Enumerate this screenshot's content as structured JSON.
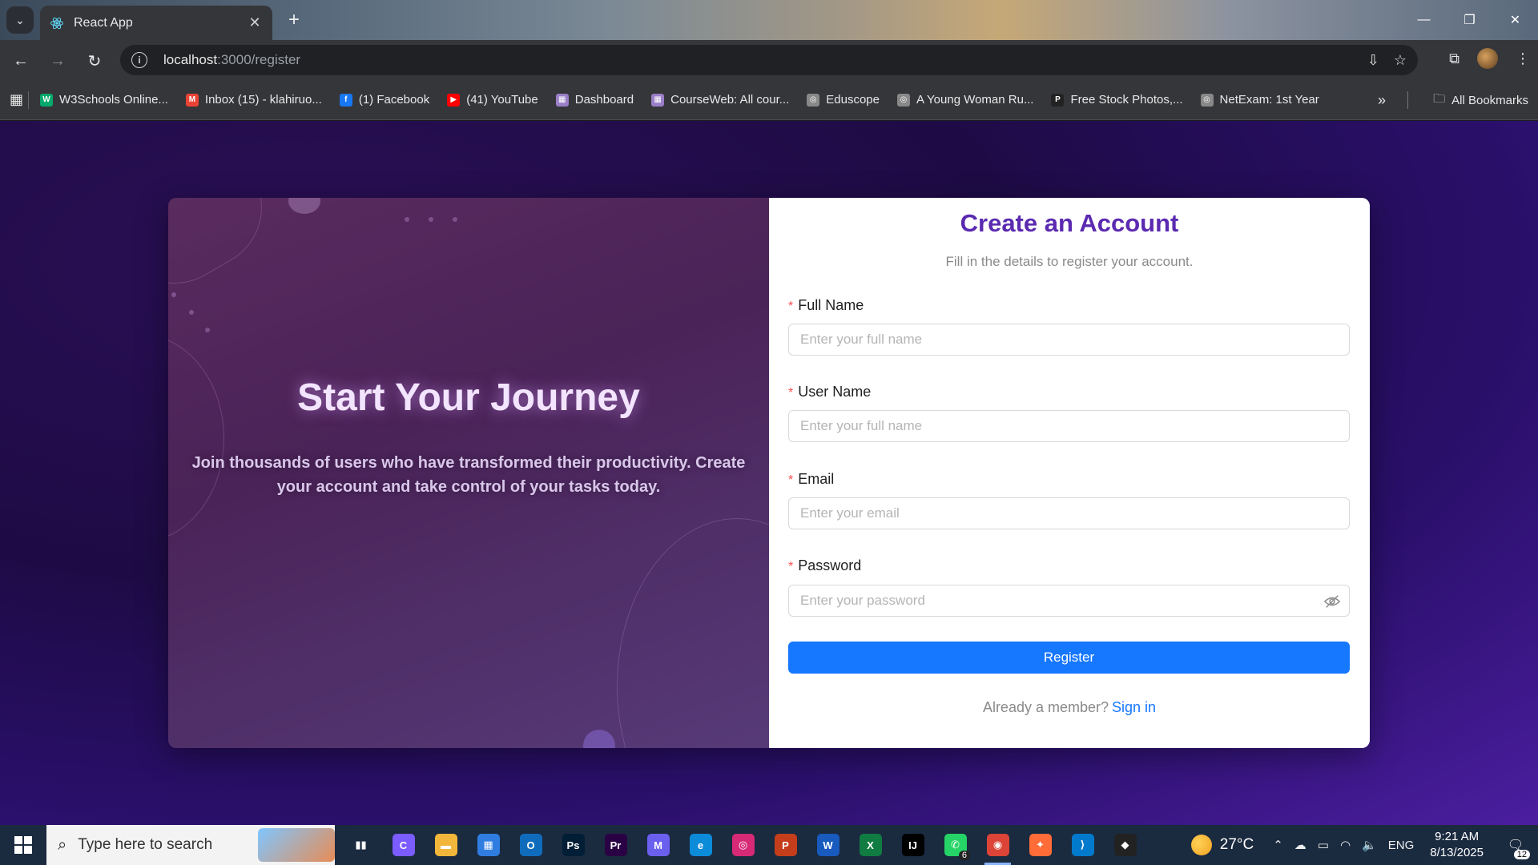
{
  "browser": {
    "tab_title": "React App",
    "url_host": "localhost",
    "url_path": ":3000/register",
    "bookmarks": [
      {
        "label": "W3Schools Online...",
        "color": "#04aa6d",
        "glyph": "W"
      },
      {
        "label": "Inbox (15) - klahiruo...",
        "color": "#ea4335",
        "glyph": "M"
      },
      {
        "label": "(1) Facebook",
        "color": "#1877f2",
        "glyph": "f"
      },
      {
        "label": "(41) YouTube",
        "color": "#ff0000",
        "glyph": "▶"
      },
      {
        "label": "Dashboard",
        "color": "#9a7fc8",
        "glyph": "▦"
      },
      {
        "label": "CourseWeb: All cour...",
        "color": "#9a7fc8",
        "glyph": "▦"
      },
      {
        "label": "Eduscope",
        "color": "#888888",
        "glyph": "◎"
      },
      {
        "label": "A Young Woman Ru...",
        "color": "#888888",
        "glyph": "◎"
      },
      {
        "label": "Free Stock Photos,...",
        "color": "#222222",
        "glyph": "P"
      },
      {
        "label": "NetExam: 1st Year",
        "color": "#888888",
        "glyph": "◎"
      }
    ],
    "all_bookmarks_label": "All Bookmarks"
  },
  "hero": {
    "title": "Start Your Journey",
    "subtitle": "Join thousands of users who have transformed their productivity. Create your account and take control of your tasks today."
  },
  "form": {
    "title": "Create an Account",
    "subtitle": "Fill in the details to register your account.",
    "required_mark": "*",
    "fields": [
      {
        "label": "Full Name",
        "placeholder": "Enter your full name"
      },
      {
        "label": "User Name",
        "placeholder": "Enter your full name"
      },
      {
        "label": "Email",
        "placeholder": "Enter your email"
      },
      {
        "label": "Password",
        "placeholder": "Enter your password"
      }
    ],
    "submit_label": "Register",
    "signin_prompt": "Already a member?",
    "signin_link": "Sign in"
  },
  "colors": {
    "accent": "#1677ff",
    "title": "#5b2ab0",
    "required": "#ff4d4f"
  },
  "taskbar": {
    "search_placeholder": "Type here to search",
    "apps": [
      {
        "name": "task-view",
        "glyph": "▮▮",
        "color": "transparent"
      },
      {
        "name": "copilot",
        "glyph": "C",
        "color": "#7b5cff"
      },
      {
        "name": "file-explorer",
        "glyph": "▬",
        "color": "#f2b73a"
      },
      {
        "name": "microsoft-store",
        "glyph": "▦",
        "color": "#2f7de1"
      },
      {
        "name": "outlook",
        "glyph": "O",
        "color": "#0f6cbd"
      },
      {
        "name": "photoshop",
        "glyph": "Ps",
        "color": "#001e36"
      },
      {
        "name": "premiere",
        "glyph": "Pr",
        "color": "#2a0045"
      },
      {
        "name": "microsoft-365",
        "glyph": "M",
        "color": "#6b5ff0"
      },
      {
        "name": "edge",
        "glyph": "e",
        "color": "#0c8bd9"
      },
      {
        "name": "instagram",
        "glyph": "◎",
        "color": "#d62976"
      },
      {
        "name": "powerpoint",
        "glyph": "P",
        "color": "#c43e1c"
      },
      {
        "name": "word",
        "glyph": "W",
        "color": "#185abd"
      },
      {
        "name": "excel",
        "glyph": "X",
        "color": "#107c41"
      },
      {
        "name": "intellij",
        "glyph": "IJ",
        "color": "#000000"
      },
      {
        "name": "whatsapp",
        "glyph": "✆",
        "color": "#25d366",
        "badge": "6"
      },
      {
        "name": "chrome",
        "glyph": "◉",
        "color": "#db4437",
        "active": true
      },
      {
        "name": "postman",
        "glyph": "✦",
        "color": "#ff6c37"
      },
      {
        "name": "vscode",
        "glyph": "⟩",
        "color": "#007acc"
      },
      {
        "name": "unity",
        "glyph": "◆",
        "color": "#222222"
      }
    ],
    "weather": "27°C",
    "language": "ENG",
    "time": "9:21 AM",
    "date": "8/13/2025",
    "notification_count": "12"
  }
}
